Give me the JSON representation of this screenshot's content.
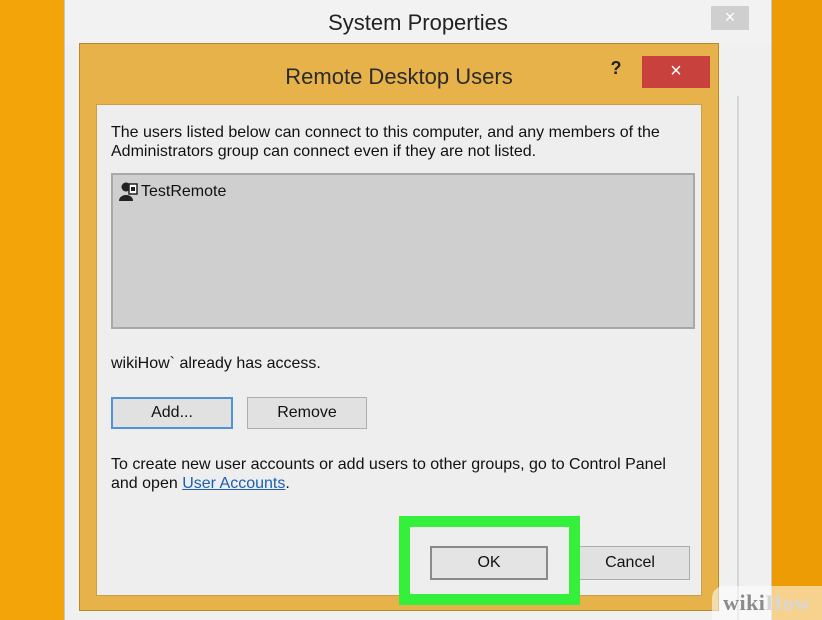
{
  "colors": {
    "background": "#f2a10a",
    "dialog_frame": "#e7b24a",
    "close_red": "#c9413d",
    "highlight_green": "#35f03a",
    "link_blue": "#1a5fb4"
  },
  "system_properties": {
    "title": "System Properties",
    "close_label": "×"
  },
  "dialog": {
    "title": "Remote Desktop Users",
    "help_label": "?",
    "close_label": "×",
    "description": "The users listed below can connect to this computer, and any members of the Administrators group can connect even if they are not listed.",
    "users": [
      {
        "name": "TestRemote",
        "icon": "user-icon"
      }
    ],
    "access_text": "wikiHow` already has access.",
    "add_label": "Add...",
    "remove_label": "Remove",
    "footer_text_before": "To create new user accounts or add users to other groups, go to Control Panel and open ",
    "footer_link": "User Accounts",
    "footer_text_after": ".",
    "ok_label": "OK",
    "cancel_label": "Cancel"
  },
  "watermark": {
    "wiki": "wiki",
    "how": "How"
  }
}
